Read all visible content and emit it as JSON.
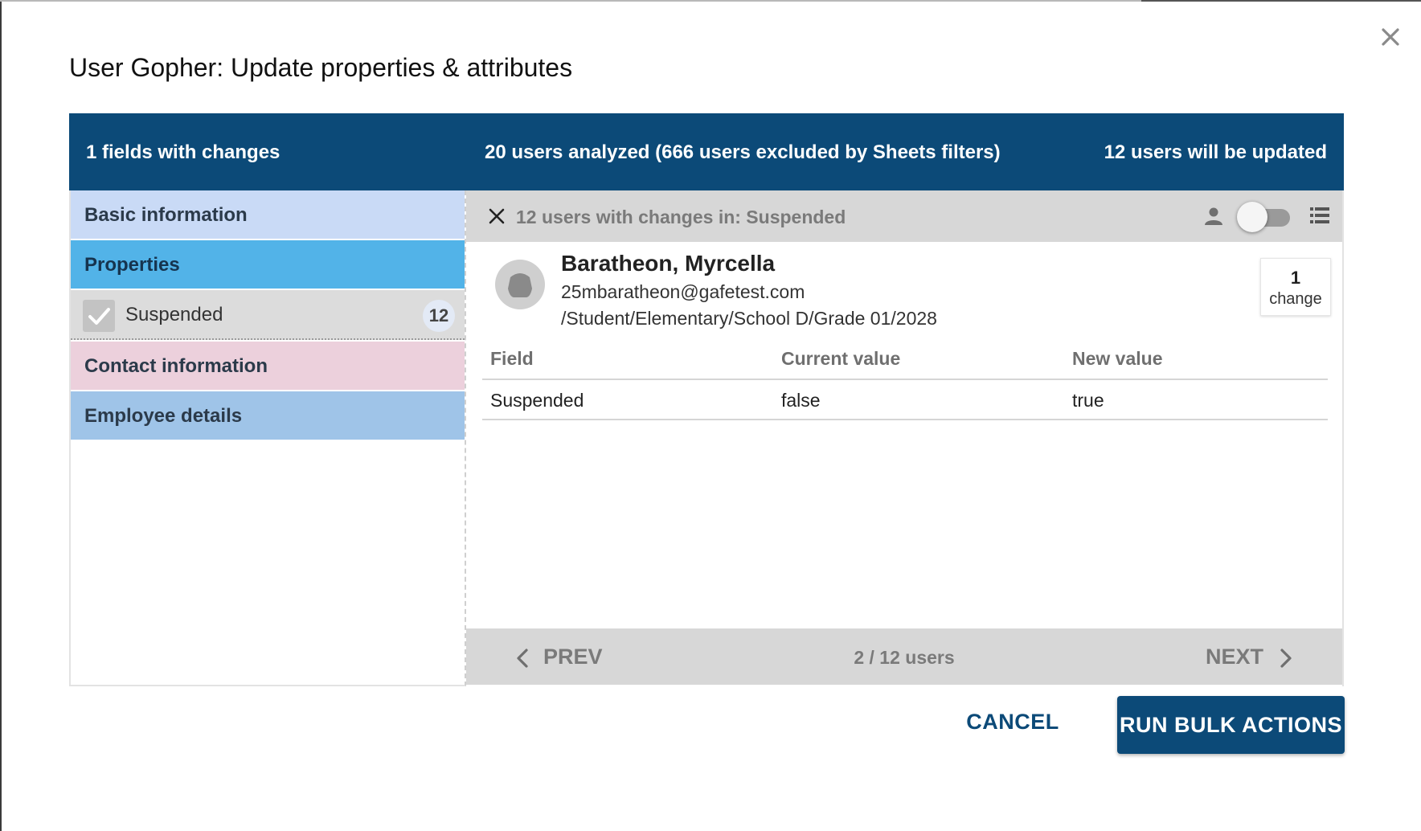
{
  "dialog": {
    "title": "User Gopher: Update properties & attributes"
  },
  "header": {
    "fields_with_changes": "1 fields with changes",
    "users_analyzed": "20 users analyzed (666 users excluded by Sheets filters)",
    "users_updated": "12 users will be updated"
  },
  "sidebar": {
    "basic": "Basic information",
    "properties": "Properties",
    "suspended": {
      "label": "Suspended",
      "count": "12",
      "checked": true
    },
    "contact": "Contact information",
    "employee": "Employee details"
  },
  "filter": {
    "text": "12 users with changes in: Suspended",
    "toggle_on": false
  },
  "user": {
    "name": "Baratheon, Myrcella",
    "email": "25mbaratheon@gafetest.com",
    "org_unit": "/Student/Elementary/School D/Grade 01/2028",
    "change_count": "1",
    "change_label": "change"
  },
  "table": {
    "headers": [
      "Field",
      "Current value",
      "New value"
    ],
    "rows": [
      [
        "Suspended",
        "false",
        "true"
      ]
    ]
  },
  "pager": {
    "prev": "PREV",
    "info": "2 / 12 users",
    "next": "NEXT"
  },
  "actions": {
    "cancel": "CANCEL",
    "run": "RUN BULK ACTIONS"
  },
  "colors": {
    "header": "#0c4a78",
    "basic": "#c9daf6",
    "properties": "#52b3e8",
    "contact": "#ecd0dc",
    "employee": "#9fc4e8"
  },
  "icons": [
    "close-icon",
    "check-icon",
    "close-filter-icon",
    "person-icon",
    "list-icon",
    "avatar-icon",
    "chevron-left-icon",
    "chevron-right-icon"
  ]
}
